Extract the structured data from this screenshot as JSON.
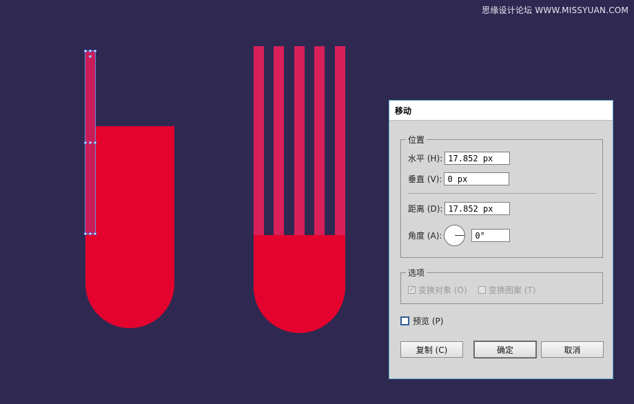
{
  "watermark": "思缘设计论坛 WWW.MISSYUAN.COM",
  "dialog": {
    "title": "移动",
    "position_group": {
      "title": "位置",
      "horizontal": {
        "label": "水平 (H):",
        "value": "17.852 px"
      },
      "vertical": {
        "label": "垂直 (V):",
        "value": "0 px"
      },
      "distance": {
        "label": "距离 (D):",
        "value": "17.852 px"
      },
      "angle": {
        "label": "角度 (A):",
        "value": "0°"
      }
    },
    "options_group": {
      "title": "选项",
      "transform_objects": {
        "label": "变换对象 (O)",
        "checked": true,
        "enabled": false
      },
      "transform_pattern": {
        "label": "变换图案 (T)",
        "checked": false,
        "enabled": false
      }
    },
    "preview": {
      "label": "预览 (P)",
      "checked": false
    },
    "buttons": {
      "copy": "复制 (C)",
      "ok": "确定",
      "cancel": "取消"
    }
  },
  "colors": {
    "background": "#2f2951",
    "shape_red": "#e4032e",
    "shape_pink": "#d81f5a",
    "dialog_border": "#53a7c7"
  }
}
